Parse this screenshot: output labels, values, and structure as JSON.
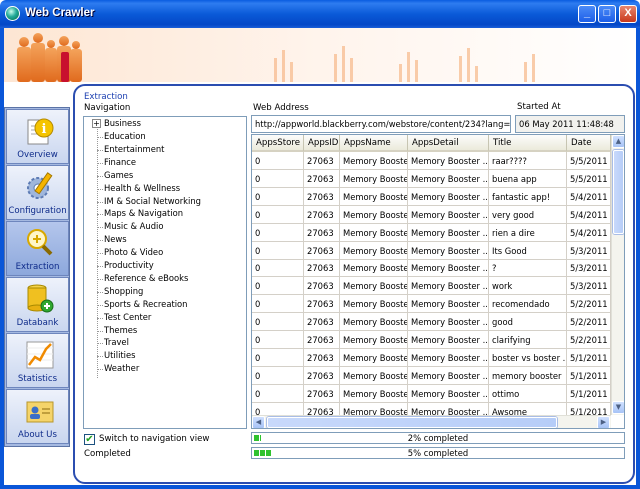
{
  "window": {
    "title": "Web Crawler",
    "minimize": "_",
    "maximize": "□",
    "close": "X"
  },
  "sidebar": {
    "items": [
      {
        "label": "Overview"
      },
      {
        "label": "Configuration"
      },
      {
        "label": "Extraction"
      },
      {
        "label": "Databank"
      },
      {
        "label": "Statistics"
      },
      {
        "label": "About Us"
      }
    ],
    "active": "Extraction"
  },
  "panel": {
    "group_title": "Extraction",
    "navigation_label": "Navigation",
    "web_address_label": "Web Address",
    "started_at_label": "Started At",
    "web_address": "http://appworld.blackberry.com/webstore/content/234?lang=en",
    "started_at": "06 May 2011 11:48:48",
    "tree_root": "Business",
    "tree_items": [
      "Education",
      "Entertainment",
      "Finance",
      "Games",
      "Health & Wellness",
      "IM & Social Networking",
      "Maps & Navigation",
      "Music & Audio",
      "News",
      "Photo & Video",
      "Productivity",
      "Reference & eBooks",
      "Shopping",
      "Sports & Recreation",
      "Test Center",
      "Themes",
      "Travel",
      "Utilities",
      "Weather"
    ],
    "switch_label": "Switch to navigation view",
    "switch_checked": true,
    "status_text": "Completed",
    "progress1": {
      "percent": 2,
      "label": "2% completed"
    },
    "progress2": {
      "percent": 5,
      "label": "5% completed"
    }
  },
  "grid": {
    "columns": [
      "AppsStore",
      "AppsID",
      "AppsName",
      "AppsDetail",
      "Title",
      "Date"
    ],
    "rows": [
      [
        "0",
        "27063",
        "Memory Booster",
        "Memory Booster ...",
        "raar????",
        "5/5/2011"
      ],
      [
        "0",
        "27063",
        "Memory Booster",
        "Memory Booster ...",
        "buena app",
        "5/5/2011"
      ],
      [
        "0",
        "27063",
        "Memory Booster",
        "Memory Booster ...",
        "fantastic app!",
        "5/4/2011"
      ],
      [
        "0",
        "27063",
        "Memory Booster",
        "Memory Booster ...",
        "very good",
        "5/4/2011"
      ],
      [
        "0",
        "27063",
        "Memory Booster",
        "Memory Booster ...",
        "rien a dire",
        "5/4/2011"
      ],
      [
        "0",
        "27063",
        "Memory Booster",
        "Memory Booster ...",
        "Its Good",
        "5/3/2011"
      ],
      [
        "0",
        "27063",
        "Memory Booster",
        "Memory Booster ...",
        "?",
        "5/3/2011"
      ],
      [
        "0",
        "27063",
        "Memory Booster",
        "Memory Booster ...",
        "work",
        "5/3/2011"
      ],
      [
        "0",
        "27063",
        "Memory Booster",
        "Memory Booster ...",
        "recomendado",
        "5/2/2011"
      ],
      [
        "0",
        "27063",
        "Memory Booster",
        "Memory Booster ...",
        "good",
        "5/2/2011"
      ],
      [
        "0",
        "27063",
        "Memory Booster",
        "Memory Booster ...",
        "clarifying",
        "5/2/2011"
      ],
      [
        "0",
        "27063",
        "Memory Booster",
        "Memory Booster ...",
        "boster vs boster ...",
        "5/1/2011"
      ],
      [
        "0",
        "27063",
        "Memory Booster",
        "Memory Booster ...",
        "memory booster",
        "5/1/2011"
      ],
      [
        "0",
        "27063",
        "Memory Booster",
        "Memory Booster ...",
        "ottimo",
        "5/1/2011"
      ],
      [
        "0",
        "27063",
        "Memory Booster",
        "Memory Booster ...",
        "Awsome",
        "5/1/2011"
      ]
    ]
  },
  "colors": {
    "titlebar": "#0a56d8",
    "panel_border": "#2b4db0",
    "group_title": "#1c3fb0",
    "link_text": "#0e2b8a",
    "progress": "#2fc22f"
  }
}
